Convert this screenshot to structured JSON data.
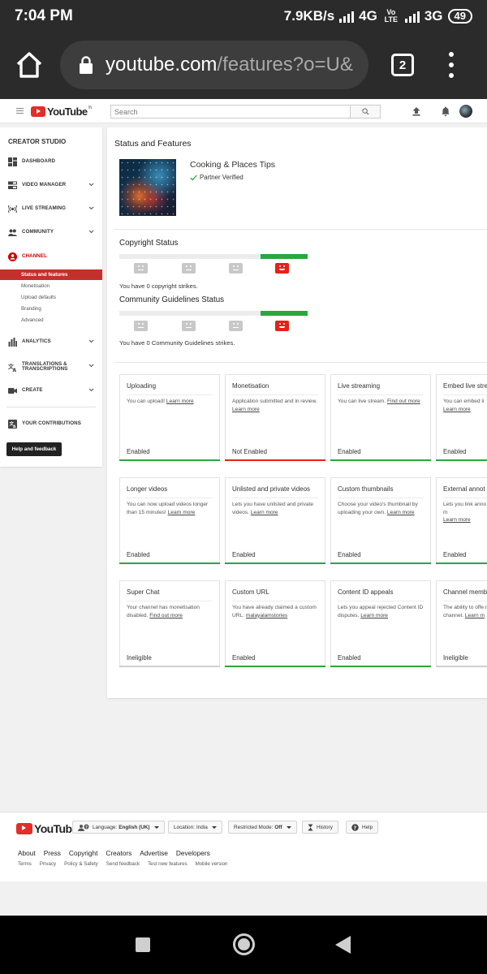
{
  "status_bar": {
    "time": "7:04 PM",
    "speed": "7.9KB/s",
    "net1": "4G",
    "volte": "Vo LTE",
    "net2": "3G",
    "battery": "49"
  },
  "browser": {
    "url_host": "youtube.com",
    "url_path": "/features?o=U&",
    "tab_count": "2"
  },
  "masthead": {
    "logo": "YouTube",
    "region": "IN",
    "search_placeholder": "Search"
  },
  "sidebar": {
    "title": "CREATOR STUDIO",
    "items": {
      "dashboard": "DASHBOARD",
      "video_manager": "VIDEO MANAGER",
      "live_streaming": "LIVE STREAMING",
      "community": "COMMUNITY",
      "channel": "CHANNEL",
      "analytics": "ANALYTICS",
      "translations": "TRANSLATIONS & TRANSCRIPTIONS",
      "create": "CREATE",
      "contributions": "YOUR CONTRIBUTIONS"
    },
    "channel_sub": [
      "Status and features",
      "Monetisation",
      "Upload defaults",
      "Branding",
      "Advanced"
    ],
    "help_button": "Help and feedback"
  },
  "main": {
    "title": "Status and Features",
    "channel_name": "Cooking & Places Tips",
    "verified": "Partner Verified",
    "copyright": {
      "heading": "Copyright Status",
      "text": "You have 0 copyright strikes."
    },
    "community": {
      "heading": "Community Guidelines Status",
      "text": "You have 0 Community Guidelines strikes."
    },
    "cards": [
      {
        "title": "Uploading",
        "desc": "You can upload!",
        "link": "Learn more",
        "status": "Enabled",
        "state": "enabled"
      },
      {
        "title": "Monetisation",
        "desc": "Application submitted and in review.",
        "link": "Learn more",
        "status": "Not Enabled",
        "state": "notenabled"
      },
      {
        "title": "Live streaming",
        "desc": "You can live stream.",
        "link": "Find out more",
        "status": "Enabled",
        "state": "enabled"
      },
      {
        "title": "Embed live stre",
        "desc": "You can embed li",
        "link": "Learn more",
        "status": "Enabled",
        "state": "enabled"
      },
      {
        "title": "Longer videos",
        "desc": "You can now upload videos longer than 15 minutes!",
        "link": "Learn more",
        "status": "Enabled",
        "state": "enabled"
      },
      {
        "title": "Unlisted and private videos",
        "desc": "Lets you have unlisted and private videos.",
        "link": "Learn more",
        "status": "Enabled",
        "state": "enabled"
      },
      {
        "title": "Custom thumbnails",
        "desc": "Choose your video's thumbnail by uploading your own.",
        "link": "Learn more",
        "status": "Enabled",
        "state": "enabled"
      },
      {
        "title": "External annot",
        "desc": "Lets you link anno external sites or m",
        "link": "Learn more",
        "status": "Enabled",
        "state": "enabled"
      },
      {
        "title": "Super Chat",
        "desc": "Your channel has monetisation disabled.",
        "link": "Find out more",
        "status": "Ineligible",
        "state": "ineligible"
      },
      {
        "title": "Custom URL",
        "desc": "You have already claimed a custom URL:",
        "link": "malayalamstories",
        "status": "Enabled",
        "state": "enabled"
      },
      {
        "title": "Content ID appeals",
        "desc": "Lets you appeal rejected Content ID disputes.",
        "link": "Learn more",
        "status": "Enabled",
        "state": "enabled"
      },
      {
        "title": "Channel memb",
        "desc": "The ability to offe isn't yet available channel.",
        "link": "Learn m",
        "status": "Ineligible",
        "state": "ineligible"
      }
    ]
  },
  "footer": {
    "logo": "YouTube",
    "language_label": "Language:",
    "language_value": "English (UK)",
    "location_label": "Location:",
    "location_value": "India",
    "restricted_label": "Restricted Mode:",
    "restricted_value": "Off",
    "history": "History",
    "help": "Help",
    "links": [
      "About",
      "Press",
      "Copyright",
      "Creators",
      "Advertise",
      "Developers"
    ],
    "sublinks": [
      "Terms",
      "Privacy",
      "Policy & Safety",
      "Send feedback",
      "Test new features",
      "Mobile version"
    ]
  },
  "colors": {
    "brand_red": "#e62117",
    "enabled_green": "#2ba640",
    "chrome_dark": "#2b2b2b"
  }
}
